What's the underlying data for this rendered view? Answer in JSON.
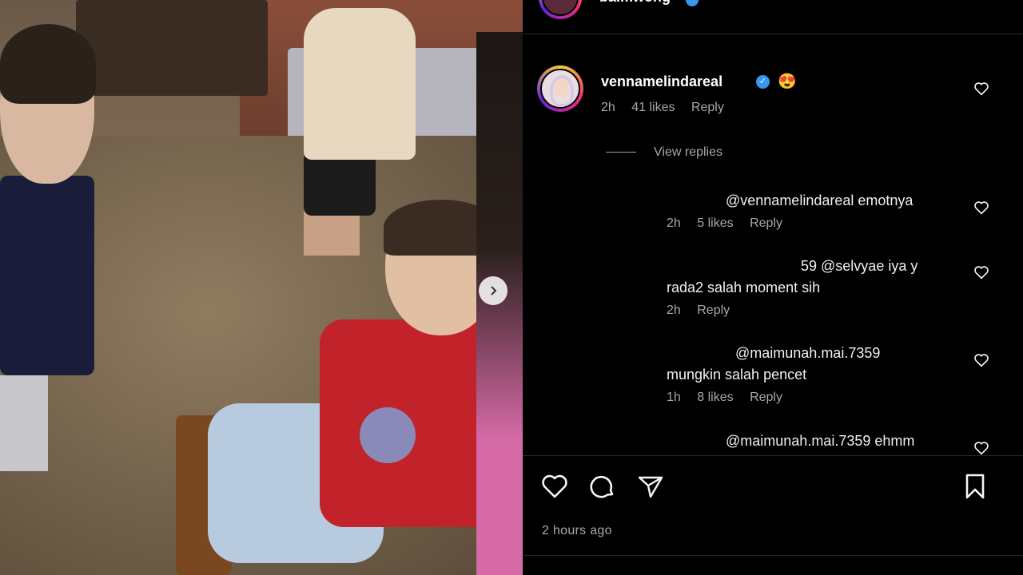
{
  "post": {
    "author": "baimwong",
    "timestamp": "2 hours ago"
  },
  "comments": {
    "main": {
      "username": "vennamelindareal",
      "emoji": "😍",
      "time": "2h",
      "likes": "41 likes",
      "reply_label": "Reply"
    },
    "view_replies_label": "View replies",
    "replies": [
      {
        "text": "@vennamelindareal emotnya",
        "time": "2h",
        "likes": "5 likes",
        "reply_label": "Reply"
      },
      {
        "text_line1": "59 @selvyae iya y",
        "text_line2": "rada2 salah moment sih",
        "time": "2h",
        "reply_label": "Reply"
      },
      {
        "text_line1": "@maimunah.mai.7359",
        "text_line2": "mungkin salah pencet",
        "time": "1h",
        "likes": "8 likes",
        "reply_label": "Reply"
      },
      {
        "text": "@maimunah.mai.7359 ehmm"
      }
    ]
  },
  "icons": {
    "like": "heart-icon",
    "comment": "comment-icon",
    "share": "send-icon",
    "save": "bookmark-icon",
    "next": "chevron-right-icon",
    "verified": "verified-badge-icon"
  },
  "colors": {
    "background": "#000000",
    "verified": "#3897f0",
    "muted_text": "#a8a8a8"
  }
}
